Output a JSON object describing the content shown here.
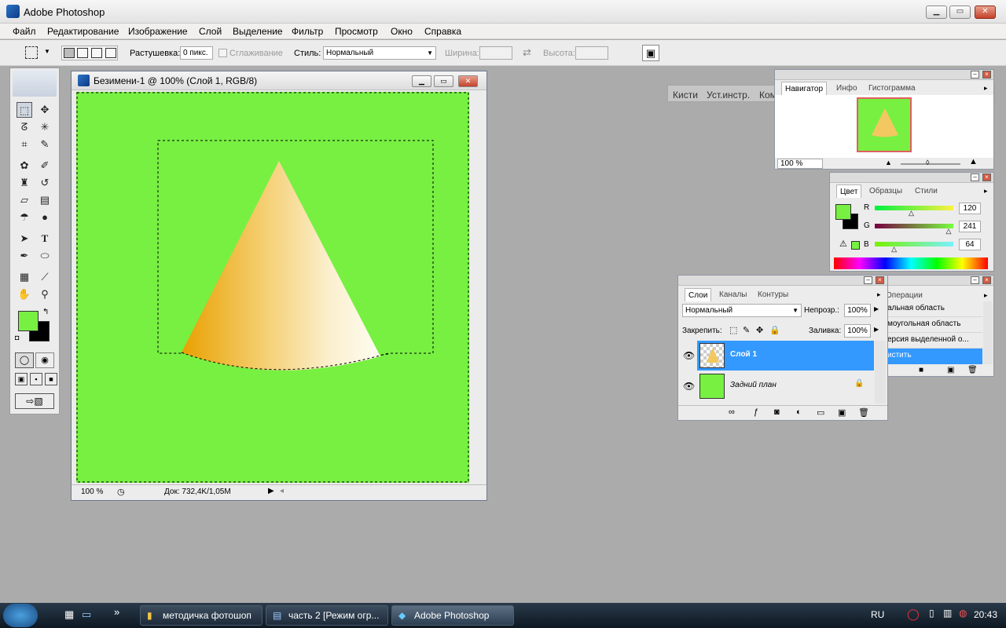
{
  "app": {
    "title": "Adobe Photoshop"
  },
  "menu": [
    "Файл",
    "Редактирование",
    "Изображение",
    "Слой",
    "Выделение",
    "Фильтр",
    "Просмотр",
    "Окно",
    "Справка"
  ],
  "options": {
    "feather_label": "Растушевка:",
    "feather_value": "0 пикс.",
    "antialias_label": "Сглаживание",
    "style_label": "Стиль:",
    "style_value": "Нормальный",
    "width_label": "Ширина:",
    "height_label": "Высота:",
    "well_tabs": [
      "Кисти",
      "Уст.инстр.",
      "Комп.слоев"
    ]
  },
  "document": {
    "title": "Безимени-1 @ 100% (Слой 1, RGB/8)",
    "zoom": "100 %",
    "doc_info": "Док: 732,4K/1,05M",
    "canvas_color": "#77f042"
  },
  "navigator": {
    "tabs": [
      "Навигатор",
      "Инфо",
      "Гистограмма"
    ],
    "zoom": "100 %"
  },
  "color_panel": {
    "tabs": [
      "Цвет",
      "Образцы",
      "Стили"
    ],
    "r_label": "R",
    "g_label": "G",
    "b_label": "B",
    "r_value": "120",
    "g_value": "241",
    "b_value": "64",
    "r": 120,
    "g": 241,
    "b": 64
  },
  "actions_panel": {
    "tabs": [
      "Операции"
    ],
    "items": [
      "альная область",
      "моугольная область",
      "ерсия выделенной о...",
      "истить"
    ]
  },
  "layers_panel": {
    "tabs": [
      "Слои",
      "Каналы",
      "Контуры"
    ],
    "blend_mode": "Нормальный",
    "opacity_label": "Непрозр.:",
    "opacity_value": "100%",
    "lock_label": "Закрепить:",
    "fill_label": "Заливка:",
    "fill_value": "100%",
    "layers": [
      {
        "name": "Слой 1",
        "selected": true
      },
      {
        "name": "Задний план",
        "selected": false
      }
    ]
  },
  "taskbar": {
    "buttons": [
      "методичка фотошоп",
      "часть 2 [Режим огр...",
      "Adobe Photoshop"
    ],
    "active_index": 2,
    "lang": "RU",
    "clock": "20:43",
    "show_more": "»"
  },
  "colors": {
    "foreground": "#77f042",
    "background": "#000000",
    "selection": "#3399ff"
  }
}
